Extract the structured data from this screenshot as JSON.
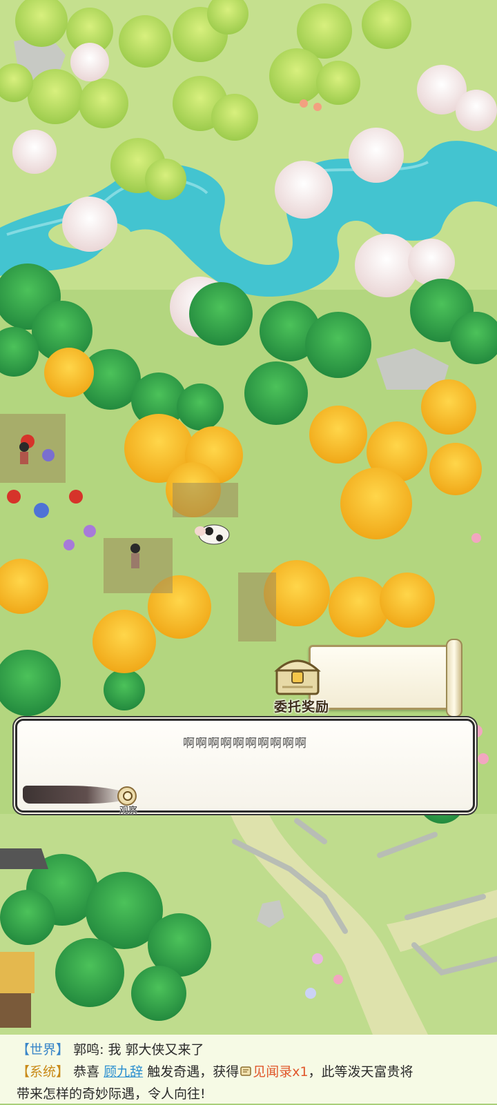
{
  "reward": {
    "label": "委托奖励"
  },
  "dialog": {
    "text": "啊啊啊啊啊啊啊啊啊啊"
  },
  "observe": {
    "label": "观察"
  },
  "chat": {
    "line1": {
      "channel": "【世界】",
      "speaker": "郭鸣:",
      "message": "我 郭大侠又来了"
    },
    "line2": {
      "channel": "【系统】",
      "prefix": "恭喜",
      "player": "顾九辞",
      "middle": "触发奇遇，获得",
      "item": "见闻录x1",
      "suffix": "，此等泼天富贵将",
      "continuation": "带来怎样的奇妙际遇，令人向往!"
    }
  }
}
